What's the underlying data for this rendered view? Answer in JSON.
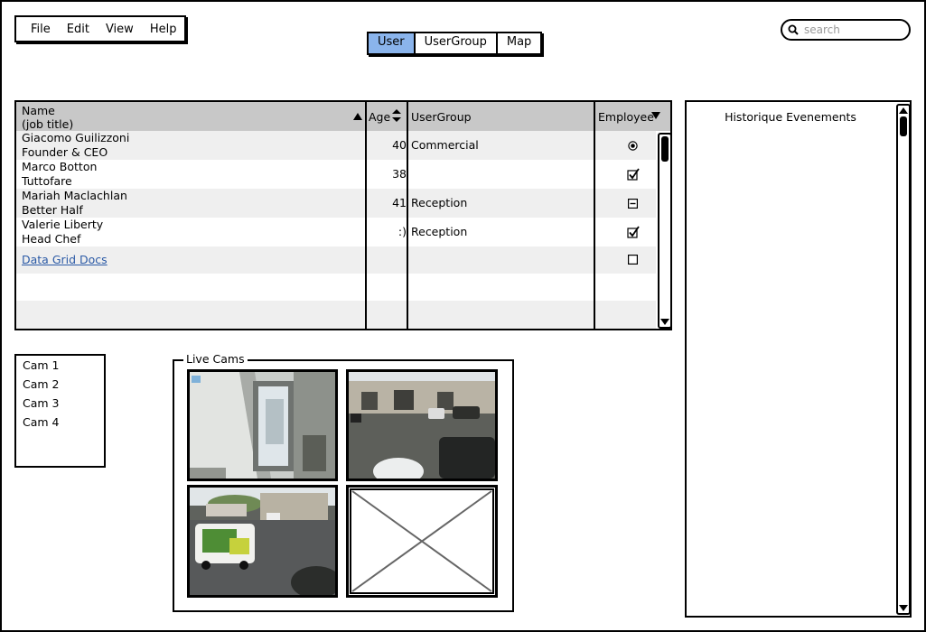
{
  "menu": {
    "items": [
      "File",
      "Edit",
      "View",
      "Help"
    ]
  },
  "tabs": [
    {
      "label": "User",
      "active": true
    },
    {
      "label": "UserGroup",
      "active": false
    },
    {
      "label": "Map",
      "active": false
    }
  ],
  "search": {
    "placeholder": "search"
  },
  "grid": {
    "columns": {
      "name": "Name",
      "name_sub": "(job title)",
      "age": "Age",
      "usergroup": "UserGroup",
      "employee": "Employee"
    },
    "rows": [
      {
        "name": "Giacomo Guilizzoni",
        "title": "Founder & CEO",
        "age": "40",
        "group": "Commercial",
        "employee": "radio-selected"
      },
      {
        "name": "Marco Botton",
        "title": "Tuttofare",
        "age": "38",
        "group": "",
        "employee": "checked"
      },
      {
        "name": "Mariah Maclachlan",
        "title": "Better Half",
        "age": "41",
        "group": "Reception",
        "employee": "indeterminate"
      },
      {
        "name": "Valerie Liberty",
        "title": "Head Chef",
        "age": ":)",
        "group": "Reception",
        "employee": "checked"
      }
    ],
    "link_row": {
      "label": "Data Grid Docs",
      "employee": "unchecked"
    }
  },
  "history": {
    "title": "Historique Evenements"
  },
  "cams": {
    "items": [
      "Cam 1",
      "Cam 2",
      "Cam 3",
      "Cam 4"
    ]
  },
  "live": {
    "title": "Live Cams"
  },
  "colors": {
    "active_tab": "#8ab4ec",
    "header_bg": "#c8c8c8",
    "link": "#2b5aa6"
  }
}
